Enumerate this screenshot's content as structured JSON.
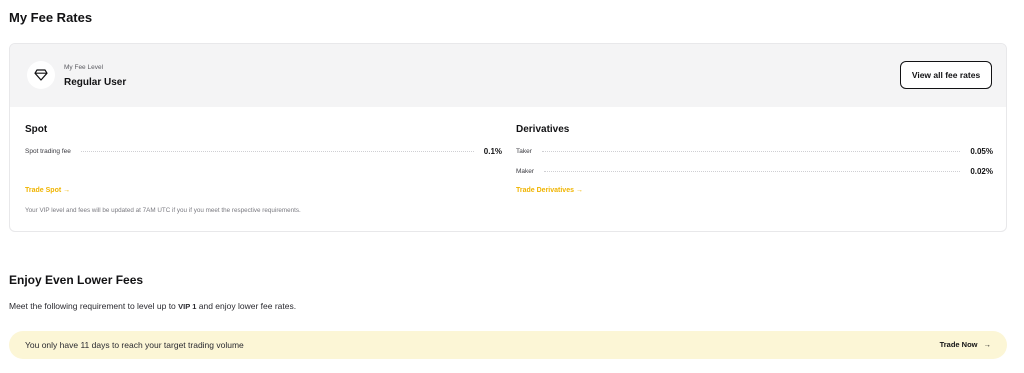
{
  "page": {
    "title": "My Fee Rates"
  },
  "fee_card": {
    "level_label": "My Fee Level",
    "level_value": "Regular User",
    "level_icon": "diamond-icon",
    "view_all_label": "View all fee rates",
    "spot": {
      "title": "Spot",
      "rows": [
        {
          "label": "Spot trading fee",
          "value": "0.1%"
        }
      ],
      "link": "Trade Spot",
      "link_arrow": "→"
    },
    "derivatives": {
      "title": "Derivatives",
      "rows": [
        {
          "label": "Taker",
          "value": "0.05%"
        },
        {
          "label": "Maker",
          "value": "0.02%"
        }
      ],
      "link": "Trade Derivatives",
      "link_arrow": "→"
    },
    "note": "Your VIP level and fees will be updated at 7AM UTC if you if you meet the respective requirements."
  },
  "lower_fees": {
    "title": "Enjoy Even Lower Fees",
    "requirement_prefix": "Meet the following requirement to level up to",
    "requirement_level": "VIP 1",
    "requirement_suffix": "and enjoy lower fee rates."
  },
  "banner": {
    "text": "You only have 11 days to reach your target trading volume",
    "button_label": "Trade Now",
    "button_arrow": "→"
  },
  "colors": {
    "accent": "#f0b400",
    "banner_bg": "#fcf6d6",
    "header_bg": "#f4f4f5"
  }
}
